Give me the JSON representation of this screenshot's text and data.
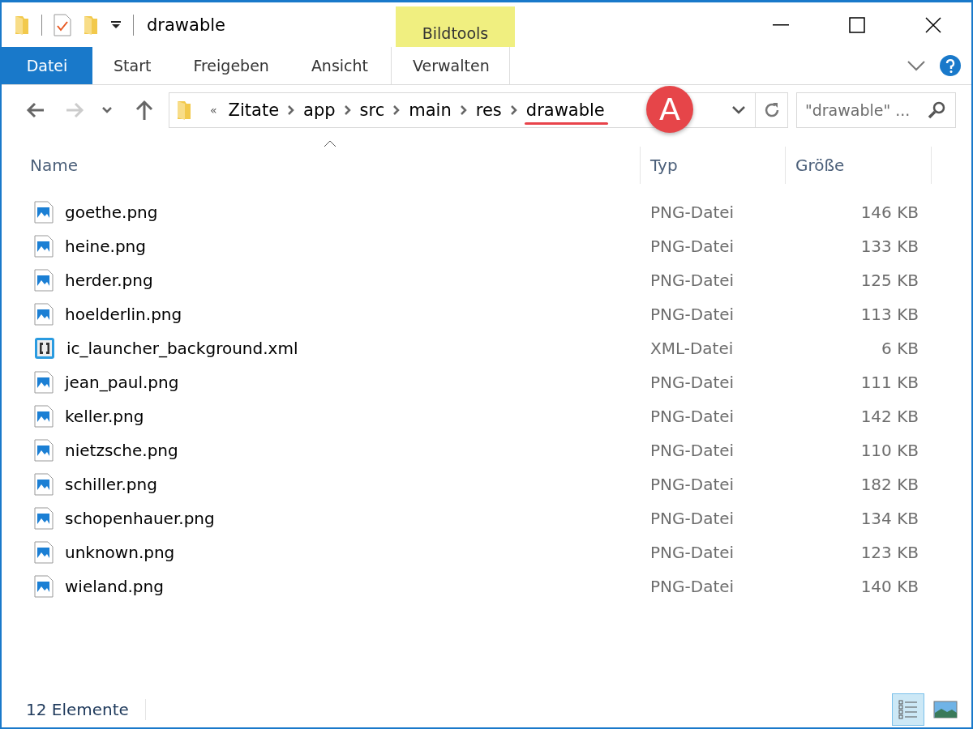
{
  "window": {
    "title": "drawable"
  },
  "contextual_tab_group": "Bildtools",
  "ribbon_tabs": [
    {
      "label": "Datei",
      "kind": "file",
      "selected": false
    },
    {
      "label": "Start",
      "kind": "tab",
      "selected": false
    },
    {
      "label": "Freigeben",
      "kind": "tab",
      "selected": false
    },
    {
      "label": "Ansicht",
      "kind": "tab",
      "selected": false
    },
    {
      "label": "Verwalten",
      "kind": "contextual",
      "selected": false
    }
  ],
  "navigation": {
    "back_disabled": false,
    "forward_disabled": true
  },
  "address_bar": {
    "overflow": "«",
    "crumbs": [
      "Zitate",
      "app",
      "src",
      "main",
      "res",
      "drawable"
    ]
  },
  "annotation": {
    "label": "A"
  },
  "search": {
    "placeholder": "\"drawable\" ..."
  },
  "table": {
    "columns": [
      "Name",
      "Typ",
      "Größe"
    ],
    "rows": [
      {
        "name": "goethe.png",
        "kind": "image",
        "type": "PNG-Datei",
        "size": "146 KB"
      },
      {
        "name": "heine.png",
        "kind": "image",
        "type": "PNG-Datei",
        "size": "133 KB"
      },
      {
        "name": "herder.png",
        "kind": "image",
        "type": "PNG-Datei",
        "size": "125 KB"
      },
      {
        "name": "hoelderlin.png",
        "kind": "image",
        "type": "PNG-Datei",
        "size": "113 KB"
      },
      {
        "name": "ic_launcher_background.xml",
        "kind": "xml",
        "type": "XML-Datei",
        "size": "6 KB"
      },
      {
        "name": "jean_paul.png",
        "kind": "image",
        "type": "PNG-Datei",
        "size": "111 KB"
      },
      {
        "name": "keller.png",
        "kind": "image",
        "type": "PNG-Datei",
        "size": "142 KB"
      },
      {
        "name": "nietzsche.png",
        "kind": "image",
        "type": "PNG-Datei",
        "size": "110 KB"
      },
      {
        "name": "schiller.png",
        "kind": "image",
        "type": "PNG-Datei",
        "size": "182 KB"
      },
      {
        "name": "schopenhauer.png",
        "kind": "image",
        "type": "PNG-Datei",
        "size": "134 KB"
      },
      {
        "name": "unknown.png",
        "kind": "image",
        "type": "PNG-Datei",
        "size": "123 KB"
      },
      {
        "name": "wieland.png",
        "kind": "image",
        "type": "PNG-Datei",
        "size": "140 KB"
      }
    ]
  },
  "status_bar": {
    "count": "12 Elemente",
    "views": [
      {
        "kind": "details",
        "selected": true
      },
      {
        "kind": "large_icons",
        "selected": false
      }
    ]
  }
}
